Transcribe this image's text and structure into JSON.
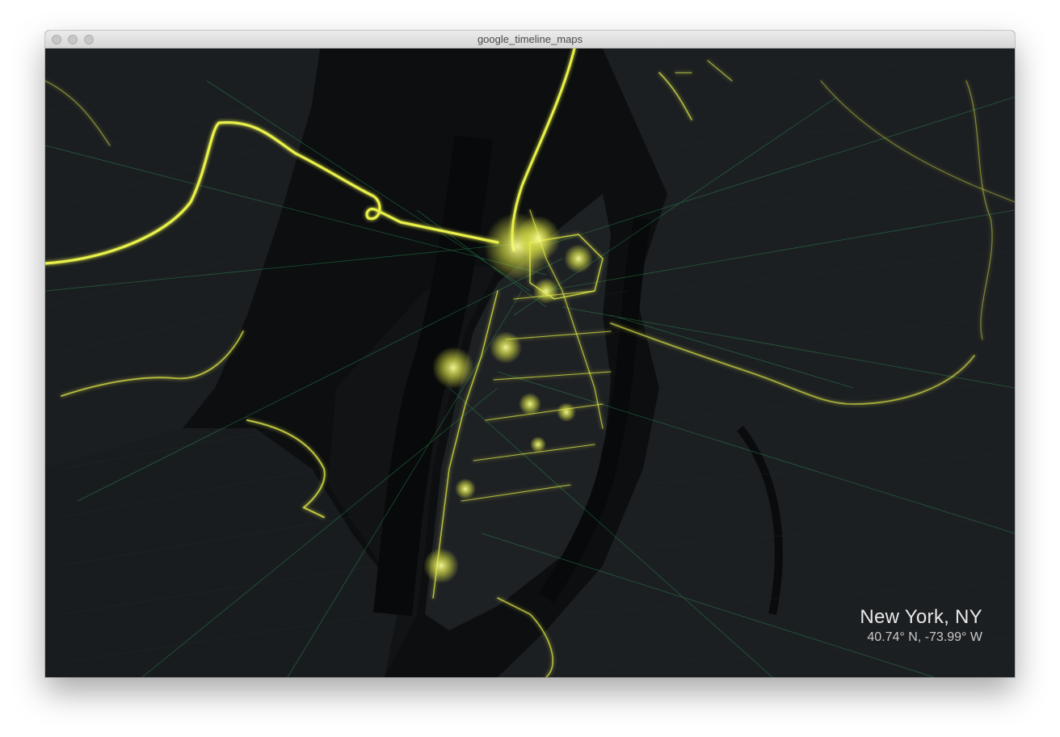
{
  "window": {
    "title": "google_timeline_maps"
  },
  "location": {
    "name": "New York, NY",
    "coords": "40.74° N, -73.99° W"
  },
  "colors": {
    "map_background": "#0c0e10",
    "land": "#1a1d20",
    "water": "#08090a",
    "track_yellow": "#e8f04a",
    "track_green": "#2fa35a"
  },
  "icons": {
    "close": "circle",
    "minimize": "circle",
    "maximize": "circle"
  }
}
